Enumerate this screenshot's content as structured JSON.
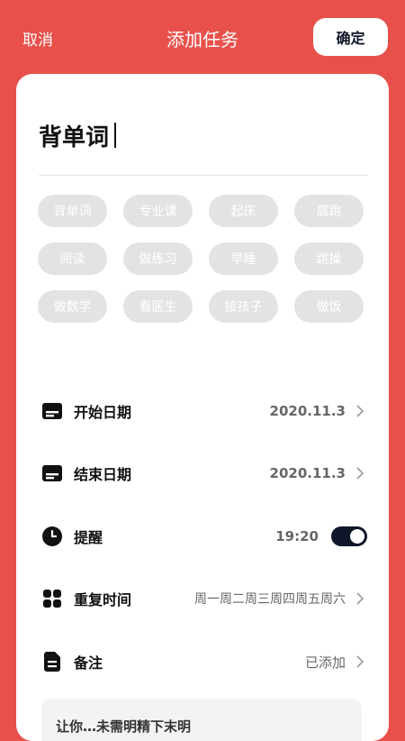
{
  "header": {
    "cancel_label": "取消",
    "title": "添加任务",
    "confirm_label": "确定"
  },
  "task_name": "背单词",
  "tags": [
    "背单词",
    "专业课",
    "起床",
    "晨跑",
    "阅读",
    "做练习",
    "早睡",
    "跳操",
    "做数学",
    "看医生",
    "接孩子",
    "做饭"
  ],
  "rows": {
    "start_date": {
      "label": "开始日期",
      "value": "2020.11.3",
      "icon": "calendar-icon"
    },
    "end_date": {
      "label": "结束日期",
      "value": "2020.11.3",
      "icon": "calendar-icon"
    },
    "reminder": {
      "label": "提醒",
      "value": "19:20",
      "icon": "clock-icon",
      "enabled": true
    },
    "repeat": {
      "label": "重复时间",
      "value": "周一周二周三周四周五周六",
      "icon": "grid-icon"
    },
    "note": {
      "label": "备注",
      "value": "已添加",
      "icon": "document-icon"
    }
  },
  "note_preview": "让你…未需明精下末明",
  "colors": {
    "accent": "#E8514B",
    "dark": "#0f1629",
    "tag_bg": "#e3e3e3"
  }
}
